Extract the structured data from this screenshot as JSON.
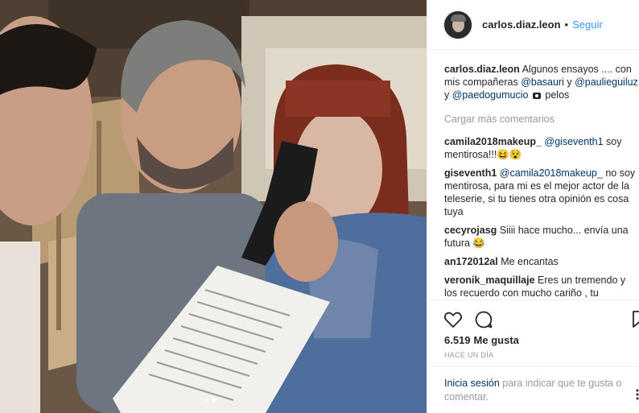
{
  "post": {
    "username": "carlos.diaz.leon",
    "follow_label": "Seguir",
    "separator": "•",
    "caption": {
      "user": "carlos.diaz.leon",
      "text_1": "Algunos ensayos .... con mis compañeras",
      "mention_1": "@basauri",
      "conj_1": "y",
      "mention_2": "@paulieguiluz",
      "conj_2": "y",
      "mention_3": "@paedogumucio",
      "text_2": "pelos"
    },
    "load_more": "Cargar más comentarios",
    "comments": [
      {
        "user": "camila2018makeup_",
        "mention": "@giseventh1",
        "text": "soy mentirosa!!!😆😵"
      },
      {
        "user": "giseventh1",
        "mention": "@camila2018makeup_",
        "text": "no soy mentirosa, para mi es el mejor actor de la teleserie, si tu tienes otra opinión es cosa tuya"
      },
      {
        "user": "cecyrojasg",
        "mention": "",
        "text": "Siiii hace mucho... envía una futura 😂"
      },
      {
        "user": "an172012al",
        "mention": "",
        "text": "Me encantas"
      },
      {
        "user": "veronik_maquillaje",
        "mention": "",
        "text": "Eres un tremendo y los recuerdo con mucho cariño , tu gentileza y respeto por mi trabajo siempre lo agradecí"
      }
    ],
    "likes_count": "6.519",
    "likes_label": "Me gusta",
    "timestamp": "HACE UN DÍA",
    "login_link": "Inicia sesión",
    "login_text": "para indicar que te gusta o comentar.",
    "carousel": {
      "total": 2,
      "active": 2
    }
  },
  "icons": {
    "like": "heart-icon",
    "comment": "comment-icon",
    "save": "bookmark-icon",
    "options": "more-options-icon"
  }
}
